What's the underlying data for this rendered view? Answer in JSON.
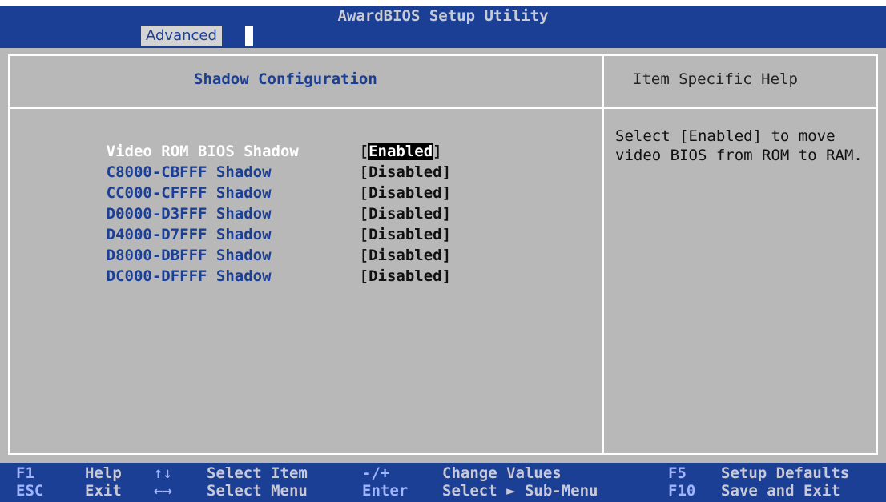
{
  "app_title": "AwardBIOS Setup Utility",
  "tabs": [
    {
      "label": "Advanced"
    }
  ],
  "panel": {
    "title": "Shadow Configuration",
    "help_title": "Item Specific Help",
    "help_text": "Select [Enabled] to move video BIOS from ROM to RAM."
  },
  "options": [
    {
      "label": "Video ROM BIOS Shadow",
      "value_prefix": "[",
      "value": "Enabled",
      "value_suffix": "]"
    },
    {
      "label": "C8000-CBFFF Shadow",
      "value": "[Disabled]"
    },
    {
      "label": "CC000-CFFFF Shadow",
      "value": "[Disabled]"
    },
    {
      "label": "D0000-D3FFF Shadow",
      "value": "[Disabled]"
    },
    {
      "label": "D4000-D7FFF Shadow",
      "value": "[Disabled]"
    },
    {
      "label": "D8000-DBFFF Shadow",
      "value": "[Disabled]"
    },
    {
      "label": "DC000-DFFFF Shadow",
      "value": "[Disabled]"
    }
  ],
  "footer": {
    "row1": [
      {
        "key": "F1",
        "desc": "Help"
      },
      {
        "key": "↑↓",
        "desc": "Select Item"
      },
      {
        "key": "-/+",
        "desc": "Change Values"
      },
      {
        "key": "F5",
        "desc": "Setup Defaults"
      }
    ],
    "row2": [
      {
        "key": "ESC",
        "desc": "Exit"
      },
      {
        "key": "←→",
        "desc": "Select Menu"
      },
      {
        "key": "Enter",
        "desc": "Select ► Sub-Menu"
      },
      {
        "key": "F10",
        "desc": "Save and Exit"
      }
    ]
  },
  "colors": {
    "bar_blue": "#1c3f96",
    "panel_gray": "#b8b8b8",
    "highlight": "#000000"
  }
}
